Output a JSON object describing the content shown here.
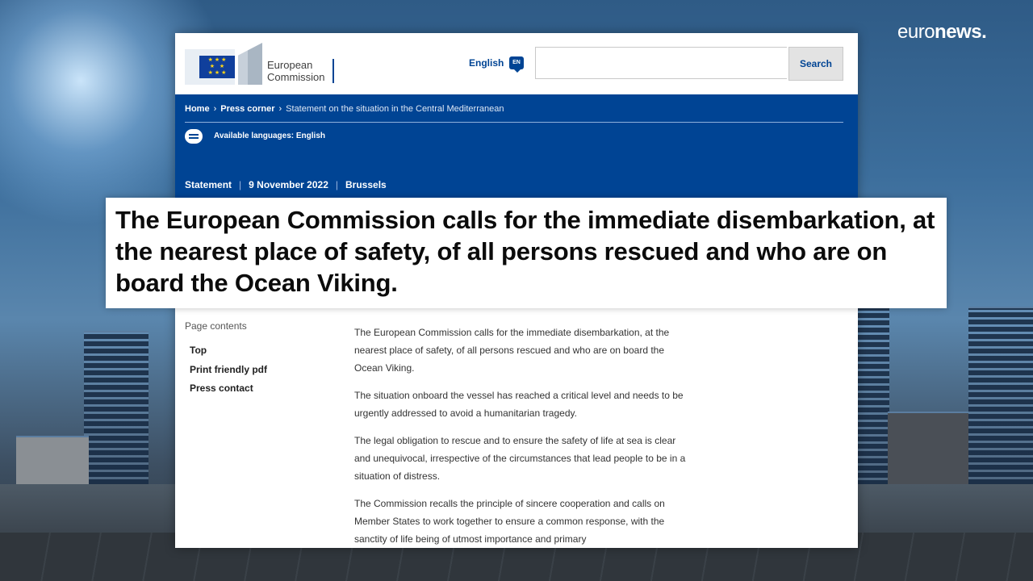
{
  "overlay": {
    "channel_logo_light": "euro",
    "channel_logo_bold": "news.",
    "caption": "The European Commission calls for the immediate disembarkation, at the nearest place of safety, of all persons rescued and who are on board the Ocean Viking."
  },
  "header": {
    "logo_line1": "European",
    "logo_line2": "Commission",
    "language_label": "English",
    "language_code": "EN",
    "search_placeholder": "",
    "search_button": "Search"
  },
  "breadcrumb": {
    "home": "Home",
    "press_corner": "Press corner",
    "current": "Statement on the situation in the Central Mediterranean"
  },
  "languages": {
    "label": "Available languages: English"
  },
  "meta": {
    "type": "Statement",
    "date": "9 November 2022",
    "place": "Brussels"
  },
  "toc": {
    "title": "Page contents",
    "items": [
      "Top",
      "Print friendly pdf",
      "Press contact"
    ]
  },
  "body": {
    "paragraphs": [
      "The European Commission calls for the immediate disembarkation, at the nearest place of safety, of all persons rescued and who are on board the Ocean Viking.",
      "The situation onboard the vessel has reached a critical level and needs to be urgently addressed to avoid a humanitarian tragedy.",
      "The legal obligation to rescue and to ensure the safety of life at sea is clear and unequivocal, irrespective of the circumstances that lead people to be in a situation of distress.",
      "The Commission recalls the principle of sincere cooperation and calls on Member States to work together to ensure a common response, with the sanctity of life being of utmost importance and primary"
    ]
  },
  "colors": {
    "ec_blue": "#004494",
    "caption_bg": "#ffffff"
  }
}
